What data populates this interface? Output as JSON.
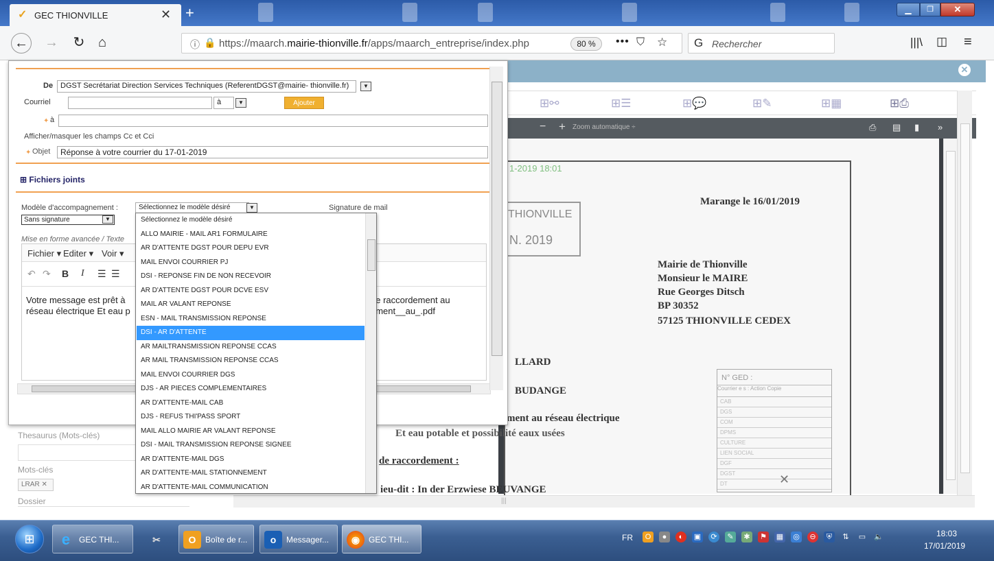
{
  "browser": {
    "tab_title": "GEC THIONVILLE",
    "url_prefix": "https://maarch.",
    "url_domain": "mairie-thionville.fr",
    "url_path": "/apps/maarch_entreprise/index.php",
    "zoom": "80 %",
    "search_placeholder": "Rechercher"
  },
  "app": {
    "zoom_label": "Zoom automatique",
    "left_fields": {
      "thesaurus_label": "Thesaurus (Mots-clés)",
      "keywords_label": "Mots-clés",
      "keyword_tag": "LRAR ✕",
      "dossier_label": "Dossier"
    },
    "document": {
      "date_overlay": "1-2019 18:01",
      "stamp_line1": "THIONVILLE",
      "stamp_line2": "N. 2019",
      "place_date": "Marange le 16/01/2019",
      "address": [
        "Mairie de Thionville",
        "Monsieur le MAIRE",
        "Rue Georges Ditsch",
        "BP 30352",
        "57125 THIONVILLE CEDEX"
      ],
      "fragment_lard": "LLARD",
      "fragment_budange": "BUDANGE",
      "fragment_reseau": "ment au réseau électrique",
      "fragment_eau": "Et eau potable et possibilité eaux usées",
      "fragment_raccord": "de raccordement :",
      "fragment_lieudit": "ieu-dit : In der Erzwiese BEUVANGE",
      "ged_title": "N° GED :",
      "ged_head": "Courrier e s :  Action  Copie",
      "ged_rows": [
        "CAB",
        "DGS",
        "COM",
        "DPMS",
        "CULTURE",
        "LIEN SOCIAL",
        "DGF",
        "DGST",
        "DT"
      ]
    }
  },
  "modal": {
    "from_label": "De",
    "from_value": "DGST Secrétariat Direction Services Techniques (ReferentDGST@mairie- thionville.fr)",
    "courriel_label": "Courriel",
    "courriel_target": "à",
    "add_button": "Ajouter",
    "to_label": "à",
    "toggle_cc": "Afficher/masquer les champs Cc et Cci",
    "object_label": "Objet",
    "object_value": "Réponse à votre courrier du 17-01-2019",
    "attachments_label": "⊞ Fichiers joints",
    "template_label": "Modèle d'accompagnement :",
    "template_selected": "Sélectionnez le modèle désiré",
    "signature_label": "Signature de mail",
    "signature_value": "Sans signature",
    "formatting_label": "Mise en forme avancée / Texte",
    "editor_menu": [
      "Fichier ▾",
      "Editer ▾",
      "Voir ▾"
    ],
    "editor_text_line1": "Votre message est prêt à",
    "editor_text_line2": "réseau électrique Et eau p",
    "editor_text_r1": "de raccordement au",
    "editor_text_r2": "ement__au_.pdf"
  },
  "dropdown": {
    "items": [
      "Sélectionnez le modèle désiré",
      "ALLO MAIRIE - MAIL AR1 FORMULAIRE",
      "AR D'ATTENTE DGST POUR DEPU EVR",
      "MAIL ENVOI COURRIER PJ",
      "DSI - REPONSE FIN DE NON RECEVOIR",
      "AR D'ATTENTE DGST POUR DCVE ESV",
      "MAIL AR VALANT REPONSE",
      "ESN - MAIL TRANSMISSION REPONSE",
      "DSI - AR D'ATTENTE",
      "AR MAILTRANSMISSION REPONSE CCAS",
      "AR MAIL TRANSMISSION REPONSE CCAS",
      "MAIL ENVOI COURRIER DGS",
      "DJS - AR PIECES COMPLEMENTAIRES",
      "AR D'ATTENTE-MAIL CAB",
      "DJS - REFUS THI'PASS SPORT",
      "MAIL ALLO MAIRIE AR VALANT REPONSE",
      "DSI - MAIL TRANSMISSION REPONSE SIGNEE",
      "AR D'ATTENTE-MAIL DGS",
      "AR D'ATTENTE-MAIL STATIONNEMENT",
      "AR D'ATTENTE-MAIL COMMUNICATION"
    ],
    "selected_index": 8
  },
  "taskbar": {
    "items": [
      "GEC THI...",
      "",
      "Boîte de r...",
      "Messager...",
      "GEC THI..."
    ],
    "lang": "FR",
    "time": "18:03",
    "date": "17/01/2019"
  },
  "colors": {
    "accent_orange": "#f0a050",
    "selection_blue": "#3399ff",
    "app_header": "#8cb1c8"
  }
}
